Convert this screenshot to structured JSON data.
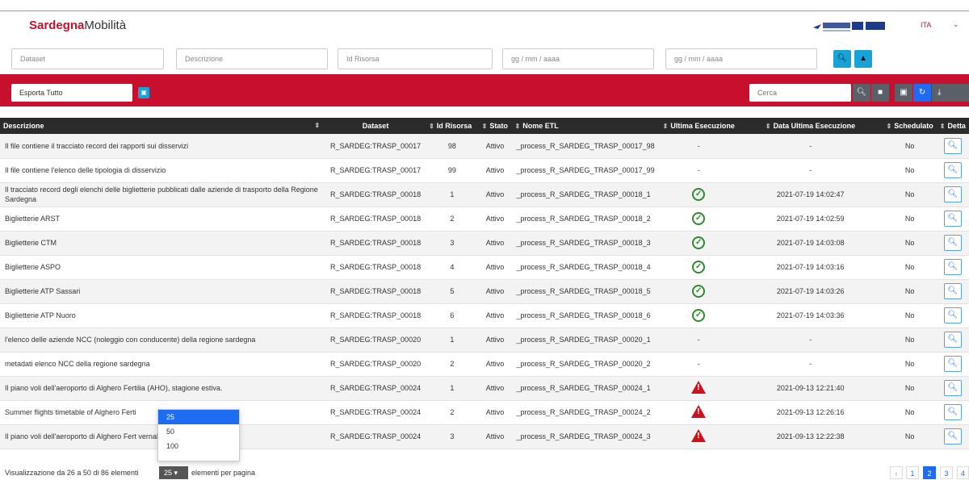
{
  "header": {
    "brand_bold": "Sardegna",
    "brand_rest": "Mobilità",
    "language": "ITA",
    "language_caret": "⌄"
  },
  "filters": {
    "dataset_placeholder": "Dataset",
    "descrizione_placeholder": "Descrizione",
    "id_risorsa_placeholder": "Id Risorsa",
    "date_from_placeholder": "gg / mm / aaaa",
    "date_to_placeholder": "gg / mm / aaaa"
  },
  "toolbar": {
    "export_label": "Esporta Tutto",
    "search_placeholder": "Cerca"
  },
  "table": {
    "headers": {
      "descrizione": "Descrizione",
      "dataset": "Dataset",
      "id_risorsa": "Id Risorsa",
      "stato": "Stato",
      "nome_etl": "Nome ETL",
      "ultima_esecuzione": "Ultima Esecuzione",
      "data_ultima": "Data Ultima Esecuzione",
      "schedulato": "Schedulato",
      "dettaglio": "Detta"
    },
    "rows": [
      {
        "descrizione": "Il file contiene il tracciato record dei rapporti sui disservizi",
        "dataset": "R_SARDEG:TRASP_00017",
        "id": "98",
        "stato": "Attivo",
        "etl": "_process_R_SARDEG_TRASP_00017_98",
        "esito": "-",
        "data": "-",
        "schedulato": "No"
      },
      {
        "descrizione": "Il file contiene l'elenco delle tipologia di disservizio",
        "dataset": "R_SARDEG:TRASP_00017",
        "id": "99",
        "stato": "Attivo",
        "etl": "_process_R_SARDEG_TRASP_00017_99",
        "esito": "-",
        "data": "-",
        "schedulato": "No"
      },
      {
        "descrizione": "Il tracciato record degli elenchi delle biglietterie pubblicati dalle aziende di trasporto della Regione Sardegna",
        "dataset": "R_SARDEG:TRASP_00018",
        "id": "1",
        "stato": "Attivo",
        "etl": "_process_R_SARDEG_TRASP_00018_1",
        "esito": "ok",
        "data": "2021-07-19 14:02:47",
        "schedulato": "No"
      },
      {
        "descrizione": "Biglietterie ARST",
        "dataset": "R_SARDEG:TRASP_00018",
        "id": "2",
        "stato": "Attivo",
        "etl": "_process_R_SARDEG_TRASP_00018_2",
        "esito": "ok",
        "data": "2021-07-19 14:02:59",
        "schedulato": "No"
      },
      {
        "descrizione": "Biglietterie CTM",
        "dataset": "R_SARDEG:TRASP_00018",
        "id": "3",
        "stato": "Attivo",
        "etl": "_process_R_SARDEG_TRASP_00018_3",
        "esito": "ok",
        "data": "2021-07-19 14:03:08",
        "schedulato": "No"
      },
      {
        "descrizione": "Biglietterie ASPO",
        "dataset": "R_SARDEG:TRASP_00018",
        "id": "4",
        "stato": "Attivo",
        "etl": "_process_R_SARDEG_TRASP_00018_4",
        "esito": "ok",
        "data": "2021-07-19 14:03:16",
        "schedulato": "No"
      },
      {
        "descrizione": "Biglietterie ATP Sassari",
        "dataset": "R_SARDEG:TRASP_00018",
        "id": "5",
        "stato": "Attivo",
        "etl": "_process_R_SARDEG_TRASP_00018_5",
        "esito": "ok",
        "data": "2021-07-19 14:03:26",
        "schedulato": "No"
      },
      {
        "descrizione": "Biglietterie ATP Nuoro",
        "dataset": "R_SARDEG:TRASP_00018",
        "id": "6",
        "stato": "Attivo",
        "etl": "_process_R_SARDEG_TRASP_00018_6",
        "esito": "ok",
        "data": "2021-07-19 14:03:36",
        "schedulato": "No"
      },
      {
        "descrizione": "l'elenco delle aziende NCC (noleggio con conducente) della regione sardegna",
        "dataset": "R_SARDEG:TRASP_00020",
        "id": "1",
        "stato": "Attivo",
        "etl": "_process_R_SARDEG_TRASP_00020_1",
        "esito": "-",
        "data": "-",
        "schedulato": "No"
      },
      {
        "descrizione": "metadati elenco NCC della regione sardegna",
        "dataset": "R_SARDEG:TRASP_00020",
        "id": "2",
        "stato": "Attivo",
        "etl": "_process_R_SARDEG_TRASP_00020_2",
        "esito": "-",
        "data": "-",
        "schedulato": "No"
      },
      {
        "descrizione": "Il piano voli dell'aeroporto di Alghero Fertilia (AHO), stagione estiva.",
        "dataset": "R_SARDEG:TRASP_00024",
        "id": "1",
        "stato": "Attivo",
        "etl": "_process_R_SARDEG_TRASP_00024_1",
        "esito": "warn",
        "data": "2021-09-13 12:21:40",
        "schedulato": "No"
      },
      {
        "descrizione": "Summer flights timetable of Alghero Ferti",
        "dataset": "R_SARDEG:TRASP_00024",
        "id": "2",
        "stato": "Attivo",
        "etl": "_process_R_SARDEG_TRASP_00024_2",
        "esito": "warn",
        "data": "2021-09-13 12:26:16",
        "schedulato": "No"
      },
      {
        "descrizione": "Il piano voli dell'aeroporto di Alghero Fert                        vernale.",
        "dataset": "R_SARDEG:TRASP_00024",
        "id": "3",
        "stato": "Attivo",
        "etl": "_process_R_SARDEG_TRASP_00024_3",
        "esito": "warn",
        "data": "2021-09-13 12:22:38",
        "schedulato": "No"
      }
    ]
  },
  "page_size_dropdown": {
    "options": [
      "25",
      "50",
      "100"
    ],
    "selected": "25"
  },
  "footer": {
    "info": "Visualizzazione da 26 a 50 di 86 elementi",
    "page_size": "25",
    "page_size_caret": "▾",
    "tail": "elementi per pagina",
    "pages": [
      "‹",
      "1",
      "2",
      "3",
      "4"
    ],
    "active_page": "2"
  },
  "colors": {
    "brand_red": "#c8102e",
    "accent_blue": "#1e6cf2",
    "teal": "#17a2d8",
    "ok_green": "#2e8b2e",
    "warn_red": "#d0101b"
  }
}
